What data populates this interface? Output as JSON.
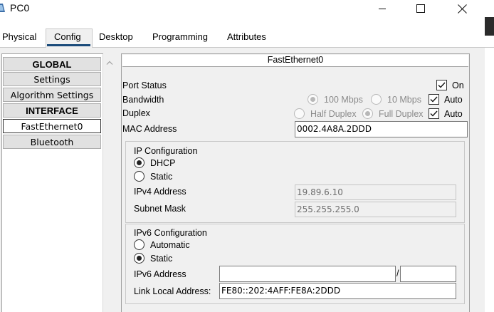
{
  "window": {
    "title": "PC0"
  },
  "tabs": [
    {
      "label": "Physical"
    },
    {
      "label": "Config"
    },
    {
      "label": "Desktop"
    },
    {
      "label": "Programming"
    },
    {
      "label": "Attributes"
    }
  ],
  "active_tab": "Config",
  "sidebar": {
    "items": [
      {
        "label": "GLOBAL",
        "type": "header"
      },
      {
        "label": "Settings",
        "type": "item"
      },
      {
        "label": "Algorithm Settings",
        "type": "item"
      },
      {
        "label": "INTERFACE",
        "type": "header"
      },
      {
        "label": "FastEthernet0",
        "type": "item",
        "selected": true
      },
      {
        "label": "Bluetooth",
        "type": "item"
      }
    ]
  },
  "interface": {
    "title": "FastEthernet0",
    "port_status": {
      "label": "Port Status",
      "on_label": "On",
      "on_checked": true
    },
    "bandwidth": {
      "label": "Bandwidth",
      "option_100": "100 Mbps",
      "option_10": "10 Mbps",
      "selected": "100 Mbps",
      "auto_label": "Auto",
      "auto_checked": true
    },
    "duplex": {
      "label": "Duplex",
      "option_half": "Half Duplex",
      "option_full": "Full Duplex",
      "selected": "Full Duplex",
      "auto_label": "Auto",
      "auto_checked": true
    },
    "mac": {
      "label": "MAC Address",
      "value": "0002.4A8A.2DDD"
    },
    "ipv4": {
      "title": "IP Configuration",
      "dhcp_label": "DHCP",
      "static_label": "Static",
      "mode": "DHCP",
      "address_label": "IPv4 Address",
      "address_value": "19.89.6.10",
      "mask_label": "Subnet Mask",
      "mask_value": "255.255.255.0"
    },
    "ipv6": {
      "title": "IPv6 Configuration",
      "automatic_label": "Automatic",
      "static_label": "Static",
      "mode": "Static",
      "address_label": "IPv6 Address",
      "address_value": "",
      "slash": "/",
      "prefix_value": "",
      "link_local_label": "Link Local Address:",
      "link_local_value": "FE80::202:4AFF:FE8A:2DDD"
    }
  },
  "colors": {
    "tab_underline": "#1a4a7a",
    "panel_bg": "#f0f0f0",
    "button_bg": "#e1e1e1"
  },
  "icons": {
    "app": "packet-tracer-pc-icon",
    "minimize": "minimize-icon",
    "maximize": "maximize-icon",
    "close": "close-icon",
    "scroll_up": "chevron-up-icon",
    "check": "check-icon"
  }
}
